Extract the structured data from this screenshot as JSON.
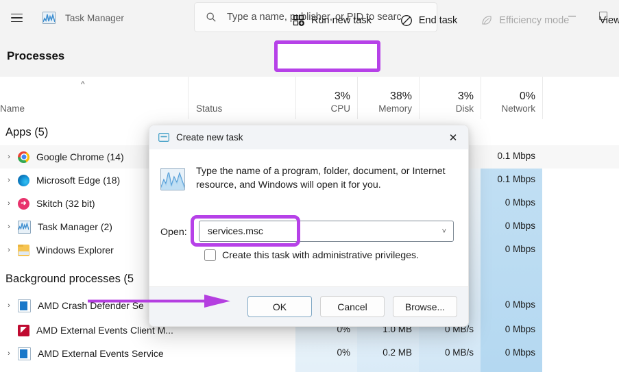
{
  "window": {
    "title": "Task Manager",
    "menu_icon": "hamburger-icon",
    "app_icon": "task-manager-icon",
    "controls": {
      "minimize": "minimize-icon",
      "maximize": "maximize-icon"
    }
  },
  "search": {
    "icon": "search-icon",
    "placeholder": "Type a name, publisher, or PID to searc",
    "value": ""
  },
  "command_bar": {
    "page_title": "Processes",
    "run_new_task": "Run new task",
    "end_task": "End task",
    "efficiency_mode": "Efficiency mode",
    "view": "View",
    "highlight_color": "#b641e8"
  },
  "columns": [
    {
      "label": "Name",
      "pct": "",
      "sort": "asc"
    },
    {
      "label": "Status",
      "pct": ""
    },
    {
      "label": "CPU",
      "pct": "3%"
    },
    {
      "label": "Memory",
      "pct": "38%"
    },
    {
      "label": "Disk",
      "pct": "3%"
    },
    {
      "label": "Network",
      "pct": "0%"
    }
  ],
  "groups": [
    {
      "label": "Apps (5)"
    },
    {
      "label": "Background processes (5"
    }
  ],
  "rows": [
    {
      "name": "Google Chrome (14)",
      "icon": "chrome-icon",
      "expandable": true,
      "status": "",
      "cpu": "",
      "memory": "",
      "disk": "",
      "network": "0.1 Mbps"
    },
    {
      "name": "Microsoft Edge (18)",
      "icon": "edge-icon",
      "expandable": true,
      "status": "",
      "cpu": "",
      "memory": "",
      "disk": "",
      "network": "0.1 Mbps"
    },
    {
      "name": "Skitch (32 bit)",
      "icon": "skitch-icon",
      "expandable": true,
      "status": "",
      "cpu": "",
      "memory": "",
      "disk": "",
      "network": "0 Mbps"
    },
    {
      "name": "Task Manager (2)",
      "icon": "task-manager-icon",
      "expandable": true,
      "status": "",
      "cpu": "",
      "memory": "",
      "disk": "",
      "network": "0 Mbps"
    },
    {
      "name": "Windows Explorer",
      "icon": "folder-icon",
      "expandable": true,
      "status": "",
      "cpu": "",
      "memory": "",
      "disk": "",
      "network": "0 Mbps"
    },
    {
      "name": "AMD Crash Defender Se",
      "icon": "service-icon",
      "expandable": true,
      "status": "",
      "cpu": "",
      "memory": "",
      "disk": "",
      "network": "0 Mbps"
    },
    {
      "name": "AMD External Events Client M...",
      "icon": "amd-icon",
      "expandable": false,
      "status": "",
      "cpu": "0%",
      "memory": "1.0 MB",
      "disk": "0 MB/s",
      "network": "0 Mbps"
    },
    {
      "name": "AMD External Events Service",
      "icon": "service-icon",
      "expandable": true,
      "status": "",
      "cpu": "0%",
      "memory": "0.2 MB",
      "disk": "0 MB/s",
      "network": "0 Mbps"
    }
  ],
  "dialog": {
    "title": "Create new task",
    "title_icon": "window-icon",
    "close_icon": "close-icon",
    "app_icon": "task-manager-icon",
    "description": "Type the name of a program, folder, document, or Internet resource, and Windows will open it for you.",
    "open_label": "Open:",
    "open_value": "services.msc",
    "open_caret": "chevron-down-icon",
    "checkbox_label": "Create this task with administrative privileges.",
    "checkbox_checked": false,
    "buttons": {
      "ok": "OK",
      "cancel": "Cancel",
      "browse": "Browse..."
    }
  },
  "annotations": {
    "arrow_color": "#b43fe0",
    "highlight_color": "#b641e8"
  }
}
